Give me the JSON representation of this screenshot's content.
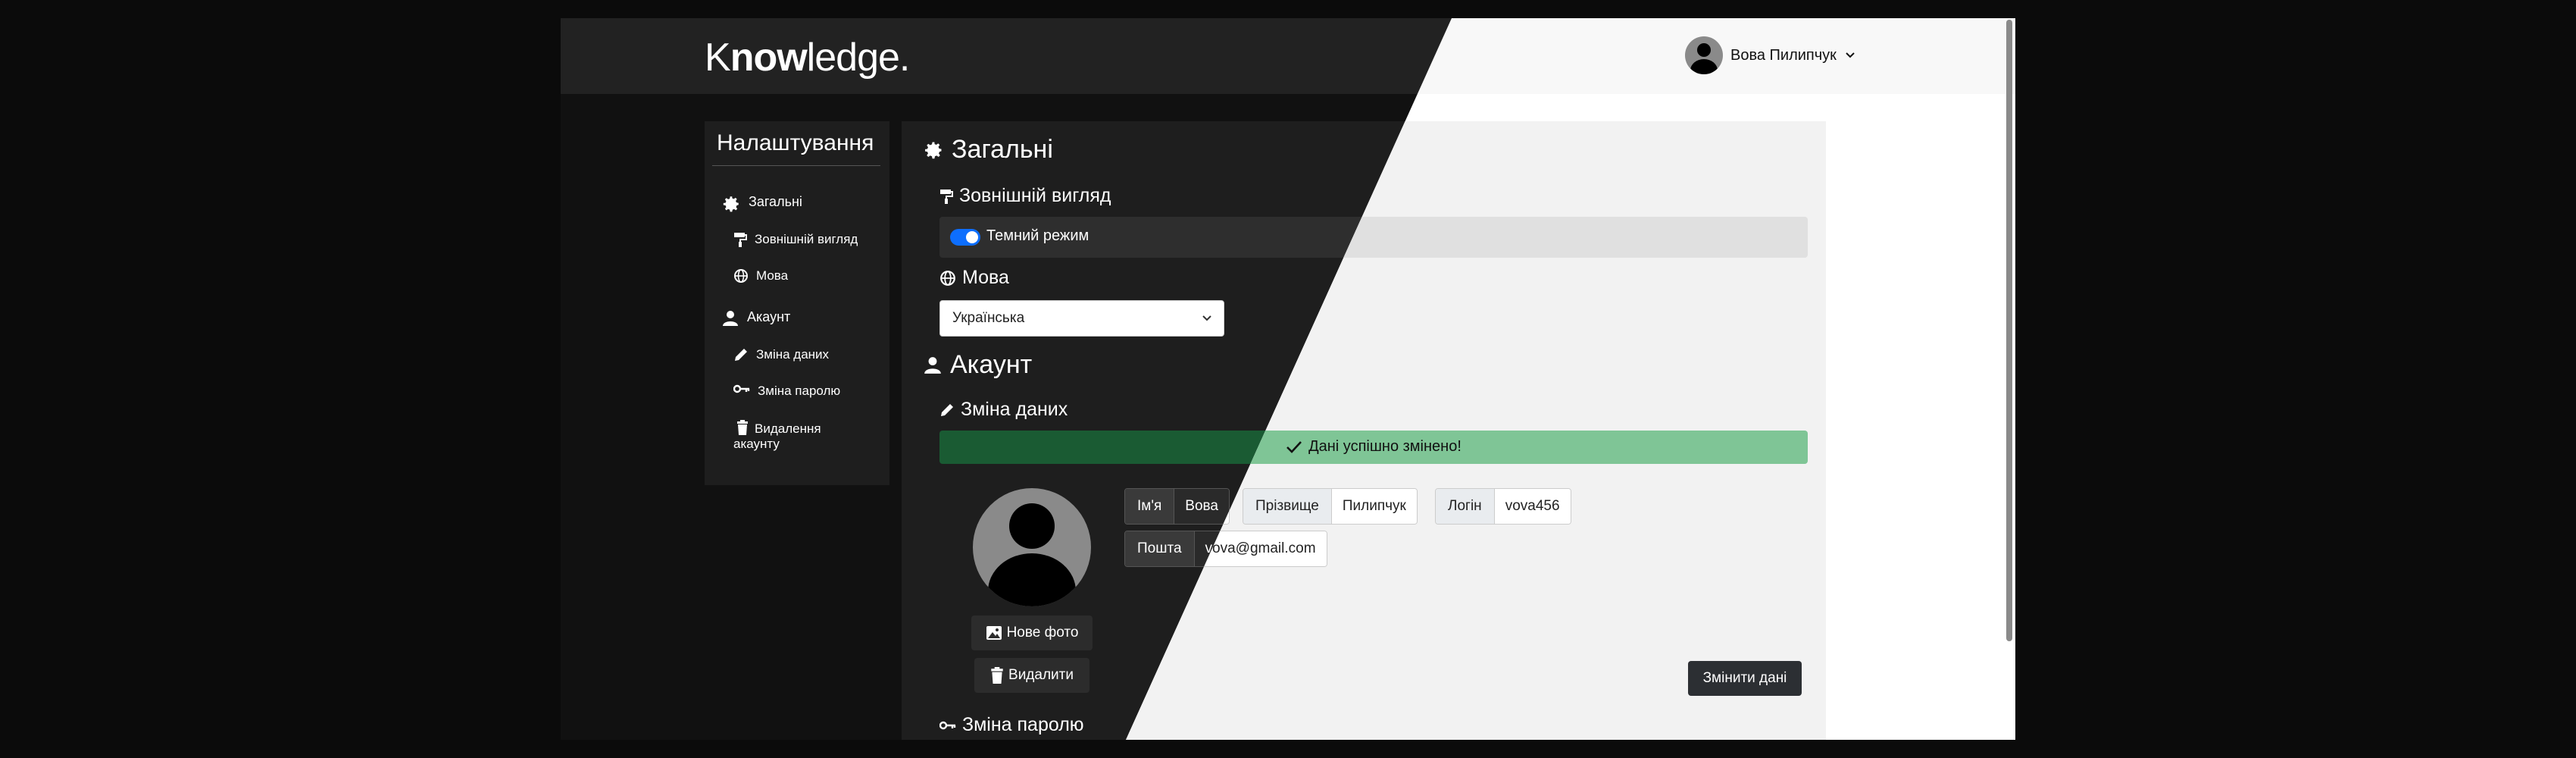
{
  "header": {
    "logo_prefix": "K",
    "logo_bold": "now",
    "logo_suffix": "ledge.",
    "user_name": "Вова Пилипчук"
  },
  "sidebar": {
    "title": "Налаштування",
    "items": [
      {
        "label": "Загальні",
        "icon": "gear-icon"
      },
      {
        "label": "Зовнішній вигляд",
        "icon": "paint-roller-icon"
      },
      {
        "label": "Мова",
        "icon": "globe-icon"
      },
      {
        "label": "Акаунт",
        "icon": "user-icon"
      },
      {
        "label": "Зміна даних",
        "icon": "pencil-icon"
      },
      {
        "label": "Зміна паролю",
        "icon": "key-icon"
      },
      {
        "label": "Видалення акаунту",
        "icon": "trash-icon"
      }
    ]
  },
  "main": {
    "general_title": "Загальні",
    "appearance_title": "Зовнішній вигляд",
    "dark_mode_label": "Темний режим",
    "dark_mode_on": true,
    "language_title": "Мова",
    "language_value": "Українська",
    "account_title": "Акаунт",
    "change_data_title": "Зміна даних",
    "success_message": "Дані успішно змінено!",
    "new_photo_label": "Нове фото",
    "delete_photo_label": "Видалити",
    "fields": {
      "first_name_label": "Ім'я",
      "first_name_value": "Вова",
      "last_name_label": "Прізвище",
      "last_name_value": "Пилипчук",
      "login_label": "Логін",
      "login_value": "vova456",
      "email_label": "Пошта",
      "email_value": "vova@gmail.com"
    },
    "submit_label": "Змінити дані",
    "change_password_title": "Зміна паролю"
  },
  "colors": {
    "accent": "#0d6efd",
    "success_dark": "#1a5b33",
    "success_light": "#7fc596",
    "dark_bg": "#111111",
    "dark_panel": "#1e1e1e"
  }
}
